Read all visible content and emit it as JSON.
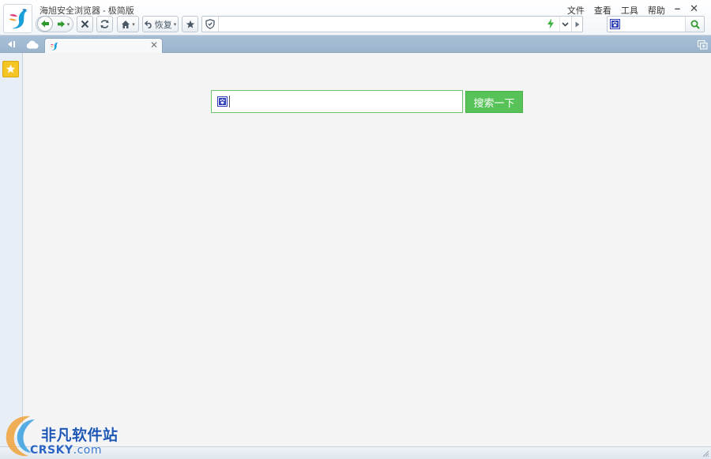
{
  "window": {
    "title": "海旭安全浏览器 - 极简版",
    "menu": [
      "文件",
      "查看",
      "工具",
      "帮助"
    ],
    "minimize_glyph": "–",
    "close_glyph": "✕"
  },
  "toolbar": {
    "restore_label": "恢复",
    "caret_glyph": "▾",
    "icons": {
      "back": "arrow-left-icon",
      "forward": "arrow-right-icon",
      "stop": "close-x-icon",
      "refresh": "refresh-icon",
      "home": "home-icon",
      "restore": "undo-icon",
      "favorite": "star-icon"
    }
  },
  "address_bar": {
    "value": "",
    "placeholder": "",
    "icons": [
      "shield-icon",
      "lightning-bolt-icon",
      "chevron-down-icon",
      "play-triangle-icon"
    ]
  },
  "search_box": {
    "value": "",
    "placeholder": "",
    "engine_icon": "paw-icon",
    "go_icon": "magnifier-icon"
  },
  "tabs": [
    {
      "label": "",
      "close_glyph": "✕",
      "active": true
    }
  ],
  "home": {
    "search_value": "",
    "search_button_label": "搜索一下",
    "colors": {
      "accent": "#57c257"
    }
  },
  "watermark": {
    "cn": "非凡软件站",
    "en": "CRSKY",
    "en_suffix": ".com"
  },
  "colors": {
    "tabstrip": "#a9c0d7",
    "content_bg": "#f4f4f4",
    "favorites": "#f5c524",
    "green_button": "#57c257"
  }
}
